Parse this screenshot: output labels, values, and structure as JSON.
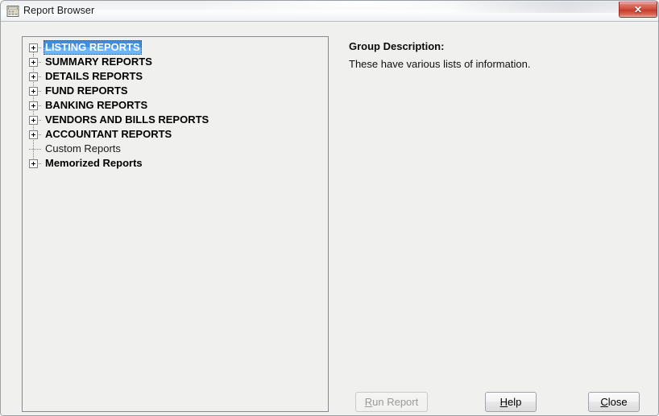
{
  "window": {
    "title": "Report Browser",
    "icon": "report-document-icon",
    "close_label": "✕",
    "close_icon": "close-icon",
    "bg_color": "#f0f0ee",
    "border_color": "#848a90"
  },
  "tree": {
    "selection_color": "#3f8de0",
    "items": [
      {
        "label": "LISTING REPORTS",
        "bold": true,
        "expandable": true,
        "selected": true
      },
      {
        "label": "SUMMARY REPORTS",
        "bold": true,
        "expandable": true,
        "selected": false
      },
      {
        "label": "DETAILS REPORTS",
        "bold": true,
        "expandable": true,
        "selected": false
      },
      {
        "label": "FUND REPORTS",
        "bold": true,
        "expandable": true,
        "selected": false
      },
      {
        "label": "BANKING REPORTS",
        "bold": true,
        "expandable": true,
        "selected": false
      },
      {
        "label": "VENDORS AND BILLS REPORTS",
        "bold": true,
        "expandable": true,
        "selected": false
      },
      {
        "label": "ACCOUNTANT REPORTS",
        "bold": true,
        "expandable": true,
        "selected": false
      },
      {
        "label": "Custom Reports",
        "bold": false,
        "expandable": false,
        "selected": false
      },
      {
        "label": "Memorized Reports",
        "bold": true,
        "expandable": true,
        "selected": false
      }
    ]
  },
  "description": {
    "heading": "Group Description:",
    "body": "These have various lists of information."
  },
  "buttons": {
    "run_report": {
      "label": "Run Report",
      "accel": "R",
      "disabled": true
    },
    "help": {
      "label": "Help",
      "accel": "H",
      "disabled": false
    },
    "close": {
      "label": "Close",
      "accel": "C",
      "disabled": false
    }
  }
}
